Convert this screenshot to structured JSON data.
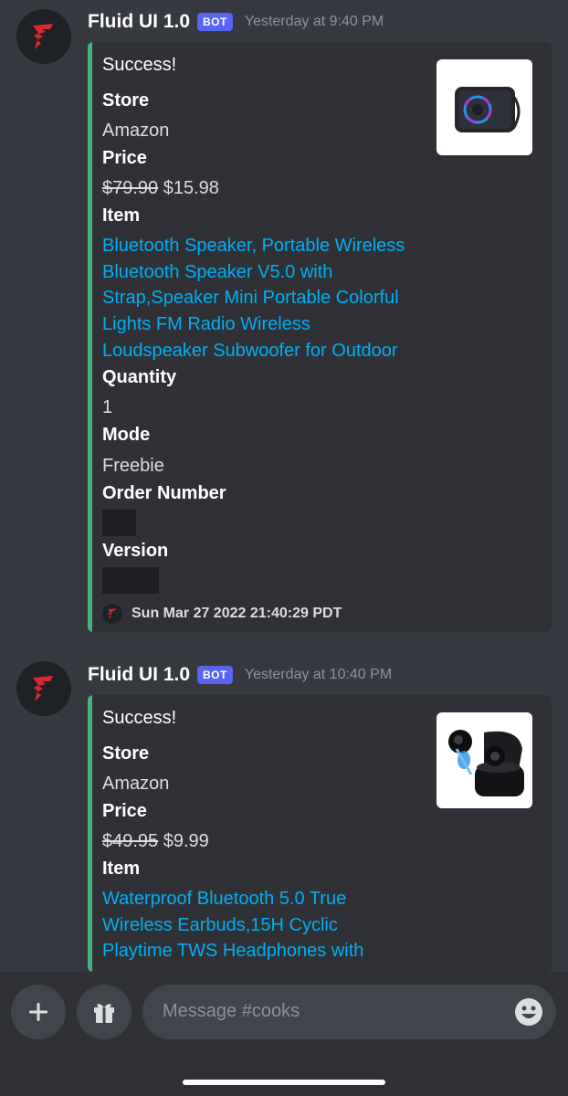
{
  "messages": [
    {
      "author": "Fluid UI 1.0",
      "badge": "BOT",
      "timestamp": "Yesterday at 9:40 PM",
      "embed": {
        "title": "Success!",
        "store_label": "Store",
        "store_value": "Amazon",
        "price_label": "Price",
        "price_old": "$79.90",
        "price_new": "$15.98",
        "item_label": "Item",
        "item_lines": [
          "Bluetooth Speaker, Portable Wireless",
          "Bluetooth Speaker V5.0 with",
          "Strap,Speaker Mini Portable Colorful",
          "Lights FM Radio Wireless",
          "Loudspeaker Subwoofer for Outdoor"
        ],
        "quantity_label": "Quantity",
        "quantity_value": "1",
        "mode_label": "Mode",
        "mode_value": "Freebie",
        "order_label": "Order Number",
        "version_label": "Version",
        "footer": "Sun Mar 27 2022 21:40:29 PDT",
        "thumbnail": "bluetooth-speaker-image"
      }
    },
    {
      "author": "Fluid UI 1.0",
      "badge": "BOT",
      "timestamp": "Yesterday at 10:40 PM",
      "embed": {
        "title": "Success!",
        "store_label": "Store",
        "store_value": "Amazon",
        "price_label": "Price",
        "price_old": "$49.95",
        "price_new": "$9.99",
        "item_label": "Item",
        "item_lines": [
          "Waterproof Bluetooth 5.0 True",
          "Wireless Earbuds,15H Cyclic",
          "Playtime TWS Headphones with"
        ],
        "thumbnail": "wireless-earbuds-image"
      }
    }
  ],
  "composer": {
    "placeholder": "Message #cooks",
    "add_icon": "plus-icon",
    "gift_icon": "gift-icon",
    "emoji_icon": "emoji-icon"
  },
  "colors": {
    "background": "#36393f",
    "embed_bg": "#2f3136",
    "embed_accent": "#43b581",
    "link": "#00aff4",
    "bot_badge": "#5865f2"
  }
}
